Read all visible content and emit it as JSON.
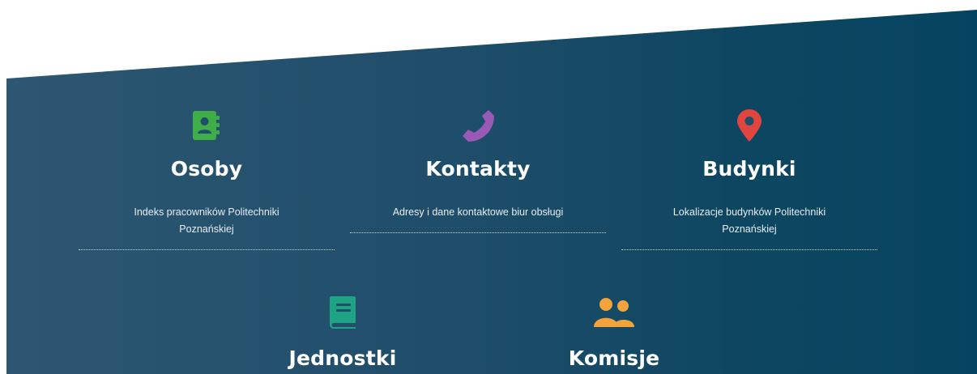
{
  "colors": {
    "band_start": "#2d5672",
    "band_end": "#054460",
    "osoby_icon": "#3fae49",
    "kontakty_icon": "#9b59b6",
    "budynki_icon": "#e2443f",
    "jednostki_icon": "#1fa385",
    "komisje_icon": "#f4a23a"
  },
  "cards": [
    {
      "icon": "address-book-icon",
      "title": "Osoby",
      "description": "Indeks pracowników Politechniki Poznańskiej"
    },
    {
      "icon": "phone-icon",
      "title": "Kontakty",
      "description": "Adresy i dane kontaktowe biur obsługi"
    },
    {
      "icon": "map-marker-icon",
      "title": "Budynki",
      "description": "Lokalizacje budynków Politechniki Poznańskiej"
    },
    {
      "icon": "book-icon",
      "title": "Jednostki"
    },
    {
      "icon": "users-icon",
      "title": "Komisje"
    }
  ]
}
